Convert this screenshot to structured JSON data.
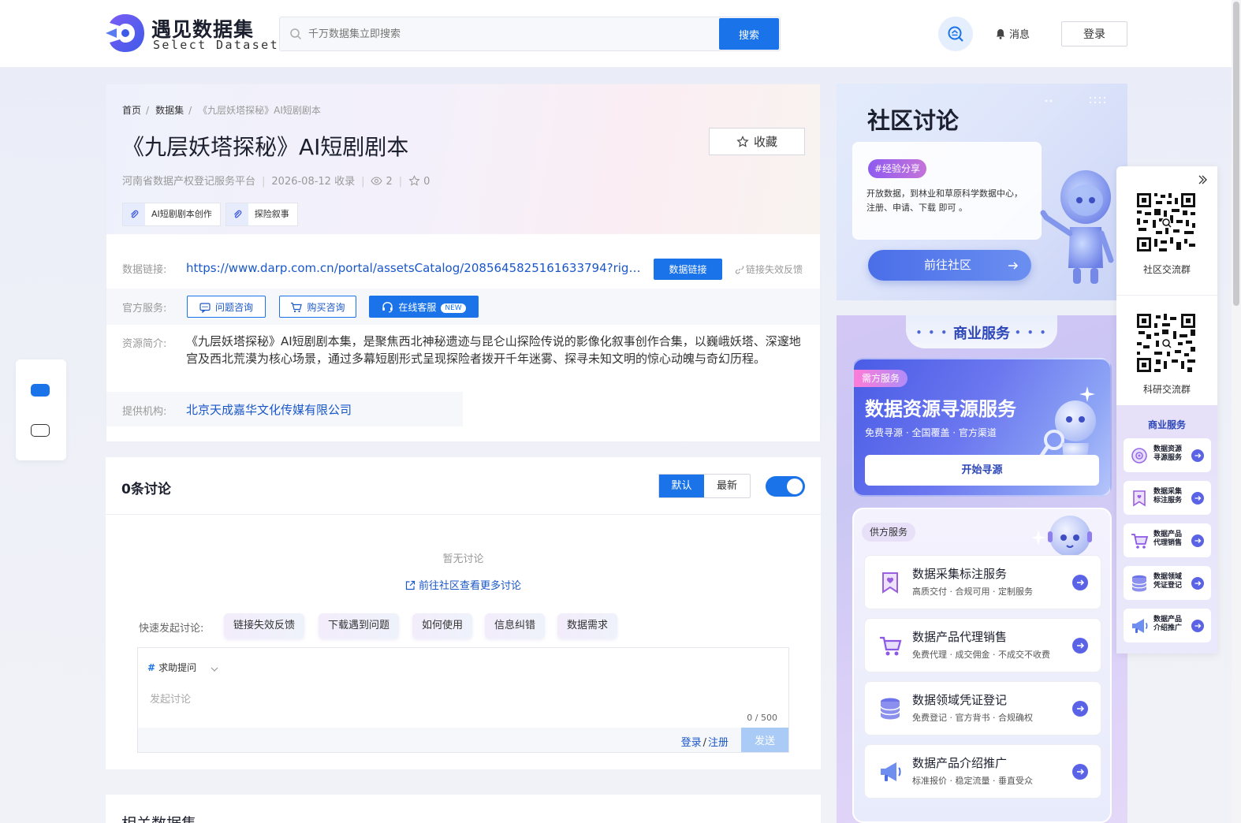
{
  "header": {
    "logo_title": "遇见数据集",
    "logo_sub": "Select Dataset",
    "search_placeholder": "千万数据集立即搜索",
    "search_button": "搜索",
    "messages": "消息",
    "login": "登录"
  },
  "breadcrumb": {
    "home": "首页",
    "datasets": "数据集",
    "current": "《九层妖塔探秘》AI短剧剧本",
    "separator": "/"
  },
  "dataset": {
    "title": "《九层妖塔探秘》AI短剧剧本",
    "favorite_label": "收藏",
    "platform": "河南省数据产权登记服务平台",
    "date": "2026-08-12 收录",
    "views": "2",
    "stars": "0",
    "tags": [
      "AI短剧剧本创作",
      "探险叙事"
    ],
    "data_link_label": "数据链接:",
    "data_link": "https://www.darp.com.cn/portal/assetsCatalog/2085645825161633794?rightHo...",
    "link_button": "数据链接",
    "link_feedback": "链接失效反馈",
    "service_label": "官方服务:",
    "service_buttons": [
      "问题咨询",
      "购买咨询",
      "在线客服"
    ],
    "new_badge": "NEW",
    "desc_label": "资源简介:",
    "description": "《九层妖塔探秘》AI短剧剧本集，是聚焦西北神秘遗迹与昆仑山探险传说的影像化叙事创作合集，以巍峨妖塔、深邃地宫及西北荒漠为核心场景，通过多幕短剧形式呈现探险者拨开千年迷雾、探寻未知文明的惊心动魄与奇幻历程。",
    "provider_label": "提供机构:",
    "provider": "北京天成嘉华文化传媒有限公司"
  },
  "discussion": {
    "title": "0条讨论",
    "sort_default": "默认",
    "sort_latest": "最新",
    "empty": "暂无讨论",
    "more_link": "前往社区查看更多讨论",
    "quick_label": "快速发起讨论:",
    "quick_chips": [
      "链接失效反馈",
      "下载遇到问题",
      "如何使用",
      "信息纠错",
      "数据需求"
    ],
    "type_hash": "#",
    "type_label": "求助提问",
    "placeholder": "发起讨论",
    "counter": "0 / 500",
    "login": "登录",
    "slash": "/",
    "register": "注册",
    "send": "发送"
  },
  "related": {
    "title": "相关数据集"
  },
  "community": {
    "title": "社区讨论",
    "badge": "#经验分享",
    "text": "开放数据，到林业和草原科学数据中心，注册、申请、下载 即可 。",
    "button": "前往社区"
  },
  "business": {
    "title": "商业服务",
    "dots_left": "• • •",
    "dots_right": "• • •",
    "demand_badge": "需方服务",
    "demand_title": "数据资源寻源服务",
    "demand_sub": "免费寻源 · 全国覆盖 · 官方渠道",
    "demand_button": "开始寻源",
    "supply_badge": "供方服务",
    "supply_items": [
      {
        "title": "数据采集标注服务",
        "sub": "高质交付 · 合规可用 · 定制服务"
      },
      {
        "title": "数据产品代理销售",
        "sub": "免费代理 · 成交佣金 · 不成交不收费"
      },
      {
        "title": "数据领域凭证登记",
        "sub": "免费登记 · 官方背书 · 合规确权"
      },
      {
        "title": "数据产品介绍推广",
        "sub": "标准报价 · 稳定流量 · 垂直受众"
      }
    ]
  },
  "side_float": {
    "qr1_label": "社区交流群",
    "qr2_label": "科研交流群",
    "biz_title": "商业服务",
    "items": [
      {
        "l1": "数据资源",
        "l2": "寻源服务"
      },
      {
        "l1": "数据采集",
        "l2": "标注服务"
      },
      {
        "l1": "数据产品",
        "l2": "代理销售"
      },
      {
        "l1": "数据领域",
        "l2": "凭证登记"
      },
      {
        "l1": "数据产品",
        "l2": "介绍推广"
      }
    ]
  },
  "colors": {
    "primary": "#1a73e8",
    "link": "#1a57c9",
    "accent_purple": "#5a63e6"
  }
}
